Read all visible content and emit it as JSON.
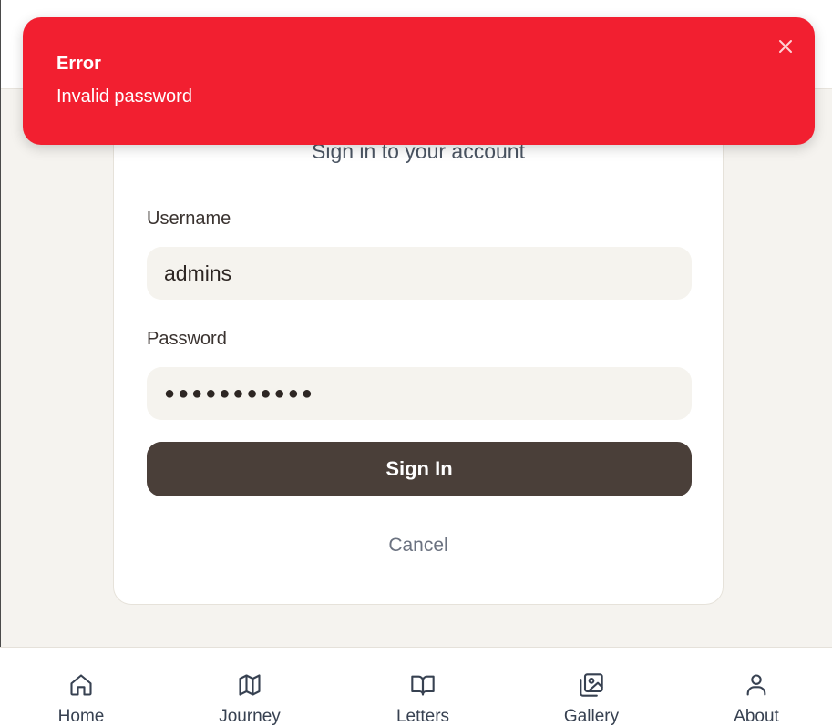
{
  "toast": {
    "title": "Error",
    "message": "Invalid password",
    "background": "#f21f30"
  },
  "form": {
    "subtitle": "Sign in to your account",
    "username_label": "Username",
    "username_value": "admins",
    "password_label": "Password",
    "password_value": "●●●●●●●●●●●",
    "submit_label": "Sign In",
    "cancel_label": "Cancel",
    "accent": "#4a3f39"
  },
  "nav": {
    "items": [
      {
        "label": "Home",
        "icon": "home-icon"
      },
      {
        "label": "Journey",
        "icon": "map-icon"
      },
      {
        "label": "Letters",
        "icon": "book-open-icon"
      },
      {
        "label": "Gallery",
        "icon": "images-icon"
      },
      {
        "label": "About",
        "icon": "user-icon"
      }
    ]
  }
}
